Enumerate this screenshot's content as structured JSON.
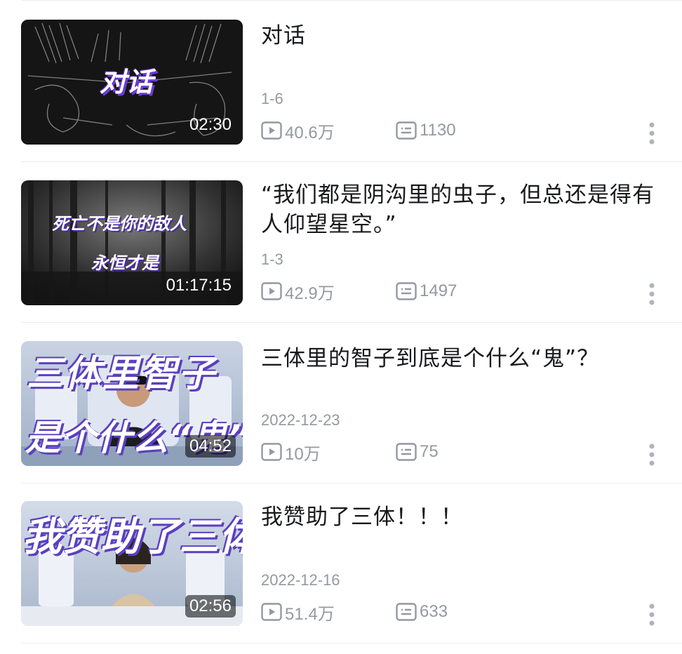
{
  "videos": [
    {
      "thumb_text": "对话",
      "duration": "02:30",
      "title": "对话",
      "date": "1-6",
      "views": "40.6万",
      "comments": "1130"
    },
    {
      "thumb_text_1": "死亡不是你的敌人",
      "thumb_text_2": "永恒才是",
      "duration": "01:17:15",
      "title": "“我们都是阴沟里的虫子，但总还是得有人仰望星空。”",
      "date": "1-3",
      "views": "42.9万",
      "comments": "1497"
    },
    {
      "thumb_text_1": "三体里智子",
      "thumb_text_2": "是个什么“鬼”?",
      "duration": "04:52",
      "title": "三体里的智子到底是个什么“鬼”？",
      "date": "2022-12-23",
      "views": "10万",
      "comments": "75"
    },
    {
      "thumb_text": "我赞助了三体!",
      "duration": "02:56",
      "title": "我赞助了三体！！！",
      "date": "2022-12-16",
      "views": "51.4万",
      "comments": "633"
    }
  ],
  "colors": {
    "meta_gray": "#9499a0",
    "title_text": "#18191c",
    "divider": "#ececec"
  },
  "icons": {
    "play_count": "play-count-icon",
    "comment_count": "danmaku-icon",
    "more": "more-vertical-icon"
  }
}
